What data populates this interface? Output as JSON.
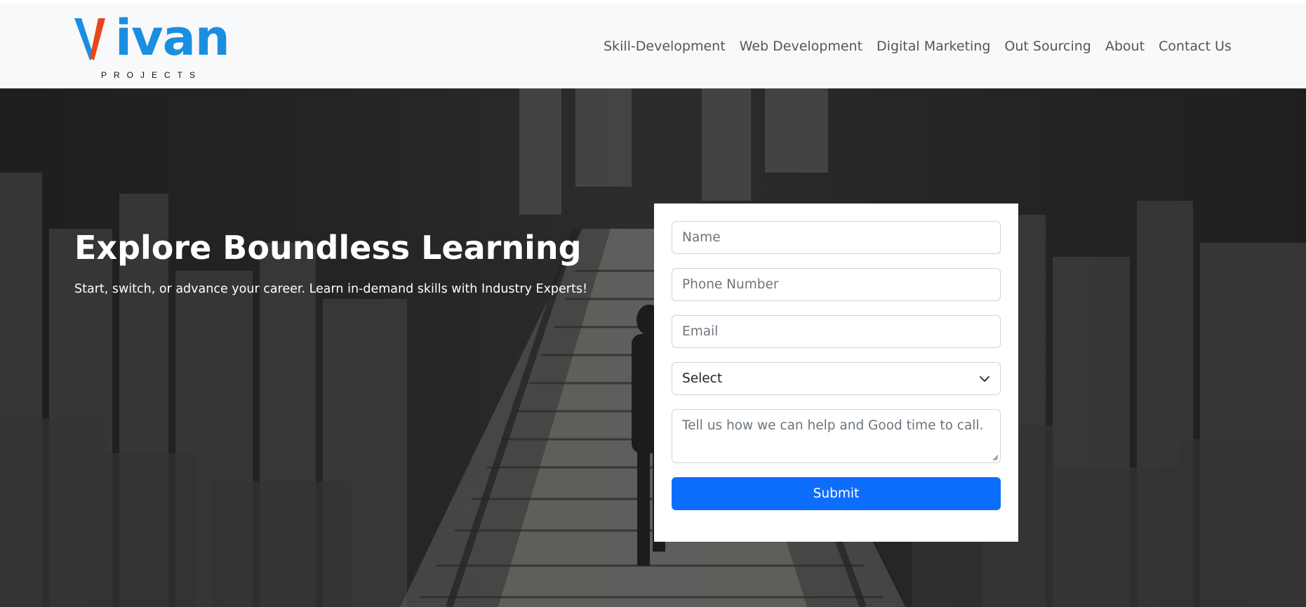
{
  "brand": {
    "logo_word_rest": "ivan",
    "logo_subtitle": "PROJECTS",
    "logo_colors": {
      "v_left": "#e8451c",
      "v_right": "#1a8ee0",
      "rest": "#1a8ee0"
    }
  },
  "nav": {
    "items": [
      {
        "label": "Skill-Development"
      },
      {
        "label": "Web Development"
      },
      {
        "label": "Digital Marketing"
      },
      {
        "label": "Out Sourcing"
      },
      {
        "label": "About"
      },
      {
        "label": "Contact Us"
      }
    ]
  },
  "hero": {
    "title": "Explore Boundless Learning",
    "subtitle": "Start, switch, or advance your career. Learn in-demand skills with Industry Experts!"
  },
  "form": {
    "name_placeholder": "Name",
    "phone_placeholder": "Phone Number",
    "email_placeholder": "Email",
    "select_value": "Select",
    "message_placeholder": "Tell us how we can help and Good time to call.",
    "submit_label": "Submit",
    "accent_color": "#0d6efd"
  },
  "icons": {
    "select_arrow": "chevron-down-icon",
    "resize": "resize-handle-icon"
  }
}
